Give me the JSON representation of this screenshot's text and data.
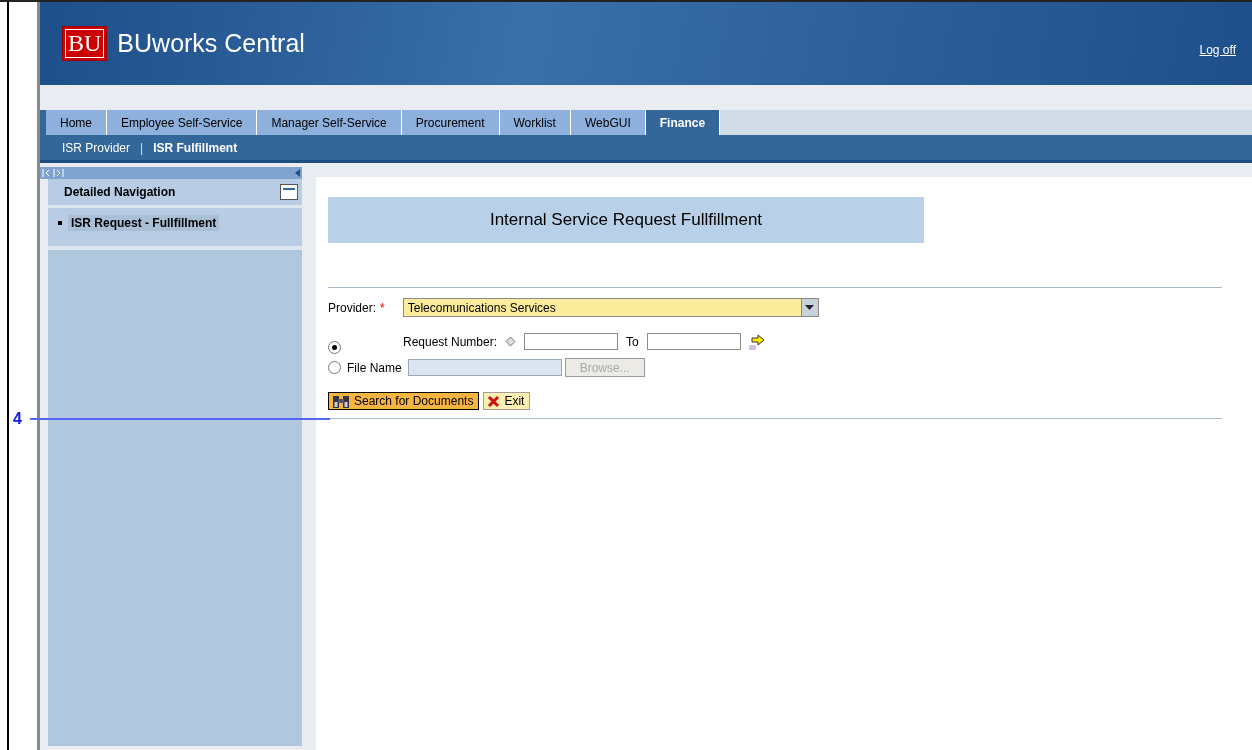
{
  "header": {
    "logo": "BU",
    "title": "BUworks Central",
    "logoff": "Log off"
  },
  "tabs": [
    {
      "label": "Home",
      "selected": false
    },
    {
      "label": "Employee Self-Service",
      "selected": false
    },
    {
      "label": "Manager Self-Service",
      "selected": false
    },
    {
      "label": "Procurement",
      "selected": false
    },
    {
      "label": "Worklist",
      "selected": false
    },
    {
      "label": "WebGUI",
      "selected": false
    },
    {
      "label": "Finance",
      "selected": true
    }
  ],
  "subnav": {
    "separator": "|",
    "items": [
      {
        "label": "ISR Provider",
        "selected": false
      },
      {
        "label": "ISR Fulfillment",
        "selected": true
      }
    ]
  },
  "sidebar": {
    "title": "Detailed Navigation",
    "expanded": true,
    "items": [
      {
        "label": "ISR Request - Fullfillment",
        "selected": true
      }
    ]
  },
  "form": {
    "heading": "Internal Service Request Fullfillment",
    "provider": {
      "label": "Provider:",
      "required": "*",
      "value": "Telecomunications Services"
    },
    "options": [
      {
        "kind": "range",
        "selected": true,
        "label": "Request Number:",
        "to": "To"
      },
      {
        "kind": "file",
        "selected": false,
        "label": "File Name",
        "browse": {
          "label": "Browse...",
          "disabled": true
        }
      }
    ],
    "buttons": [
      {
        "kind": "search",
        "label": "Search for Documents"
      },
      {
        "kind": "exit",
        "label": "Exit"
      }
    ]
  },
  "callout": {
    "number": "4"
  }
}
